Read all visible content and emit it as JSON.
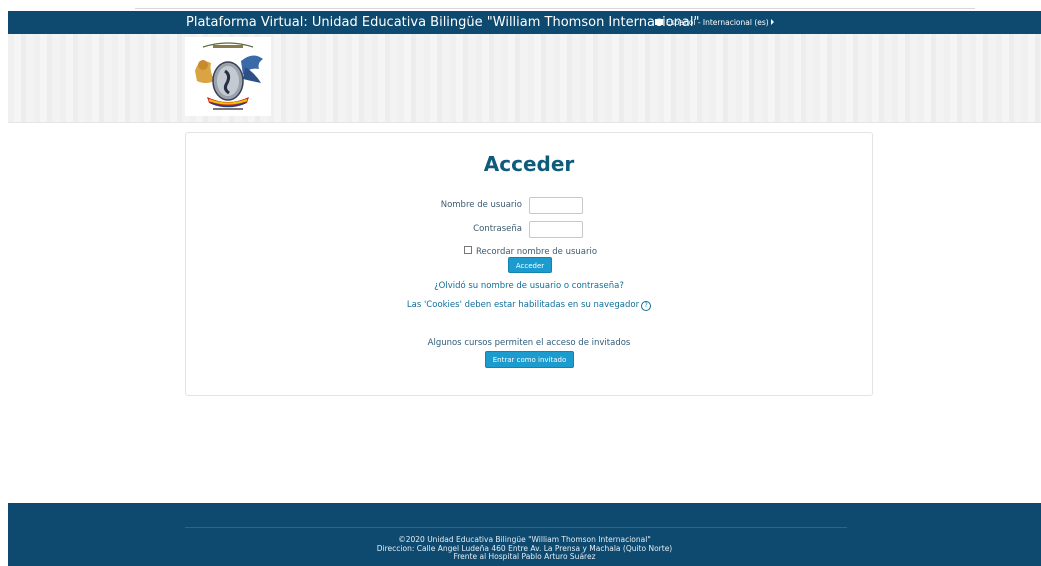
{
  "header": {
    "site_title": "Plataforma Virtual: Unidad Educativa Bilingüe \"William Thomson Internacional\"",
    "language": "Español - Internacional (es)"
  },
  "login": {
    "title": "Acceder",
    "username_label": "Nombre de usuario",
    "username_value": "",
    "password_label": "Contraseña",
    "password_value": "",
    "remember_label": "Recordar nombre de usuario",
    "remember_checked": false,
    "submit_label": "Acceder",
    "forgot_link": "¿Olvidó su nombre de usuario o contraseña?",
    "cookies_note": "Las 'Cookies' deben estar habilitadas en su navegador",
    "guest_note": "Algunos cursos permiten el acceso de invitados",
    "guest_button": "Entrar como invitado"
  },
  "footer": {
    "line1": "©2020 Unidad Educativa Bilingüe \"William Thomson Internacional\"",
    "line2": "Direccion: Calle Angel Ludeña 460 Entre Av. La Prensa y Machala (Quito Norte)",
    "line3": "Frente al Hospital Pablo Arturo Suárez"
  },
  "colors": {
    "navbar": "#0e4a6f",
    "accent": "#1c9bce",
    "title": "#0e5b7c"
  },
  "icons": [
    "flag-icon",
    "caret-right-icon",
    "help-icon",
    "school-crest-logo"
  ]
}
